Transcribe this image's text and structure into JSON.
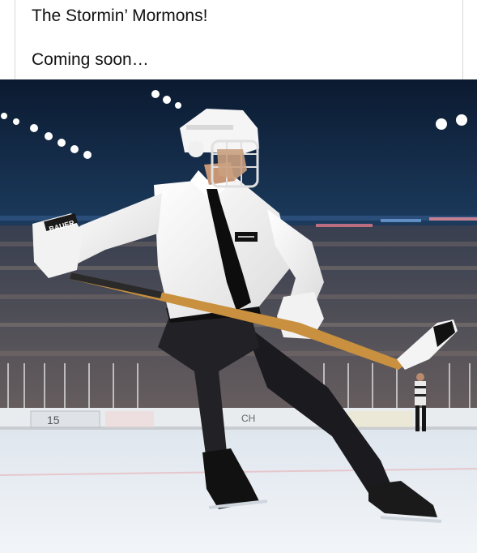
{
  "post": {
    "lines": [
      "The Stormin’ Mormons!",
      "Coming soon…"
    ]
  },
  "image": {
    "subject": "hockey player in white shirt, black tie, black pants and helmet skating with stick in an arena",
    "helmet_brand": "BAUER",
    "boards_text": [
      "CH",
      "15"
    ],
    "colors": {
      "arena_dark": "#0d1b33",
      "ice": "#e8eef4",
      "shirt": "#f4f4f2",
      "pants": "#1b1b1f",
      "stick": "#c8903f"
    }
  }
}
